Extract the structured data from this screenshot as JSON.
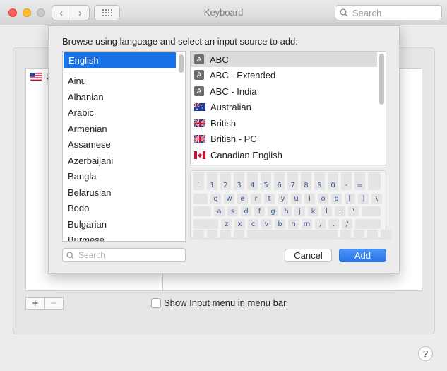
{
  "window": {
    "title": "Keyboard",
    "search_placeholder": "Search"
  },
  "background": {
    "input_source_abbrev": "U",
    "show_input_menu_label": "Show Input menu in menu bar",
    "plus_label": "+",
    "minus_label": "−",
    "help_label": "?"
  },
  "sheet": {
    "prompt": "Browse using language and select an input source to add:",
    "languages": [
      {
        "label": "English",
        "selected": true
      },
      {
        "label": "Ainu"
      },
      {
        "label": "Albanian"
      },
      {
        "label": "Arabic"
      },
      {
        "label": "Armenian"
      },
      {
        "label": "Assamese"
      },
      {
        "label": "Azerbaijani"
      },
      {
        "label": "Bangla"
      },
      {
        "label": "Belarusian"
      },
      {
        "label": "Bodo"
      },
      {
        "label": "Bulgarian"
      },
      {
        "label": "Burmese"
      }
    ],
    "sources": [
      {
        "label": "ABC",
        "icon": "A",
        "selected": true
      },
      {
        "label": "ABC - Extended",
        "icon": "A"
      },
      {
        "label": "ABC - India",
        "icon": "A"
      },
      {
        "label": "Australian",
        "icon": "flag-au"
      },
      {
        "label": "British",
        "icon": "flag-gb"
      },
      {
        "label": "British - PC",
        "icon": "flag-gb"
      },
      {
        "label": "Canadian English",
        "icon": "flag-ca"
      }
    ],
    "keyboard_rows": [
      [
        "`",
        "1",
        "2",
        "3",
        "4",
        "5",
        "6",
        "7",
        "8",
        "9",
        "0",
        "-",
        "="
      ],
      [
        "q",
        "w",
        "e",
        "r",
        "t",
        "y",
        "u",
        "i",
        "o",
        "p",
        "[",
        "]",
        "\\"
      ],
      [
        "a",
        "s",
        "d",
        "f",
        "g",
        "h",
        "j",
        "k",
        "l",
        ";",
        "'"
      ],
      [
        "z",
        "x",
        "c",
        "v",
        "b",
        "n",
        "m",
        ",",
        ".",
        "/"
      ]
    ],
    "search_placeholder": "Search",
    "cancel_label": "Cancel",
    "add_label": "Add"
  },
  "colors": {
    "accent": "#1a72e8",
    "key_text": "#3b5a9a"
  }
}
